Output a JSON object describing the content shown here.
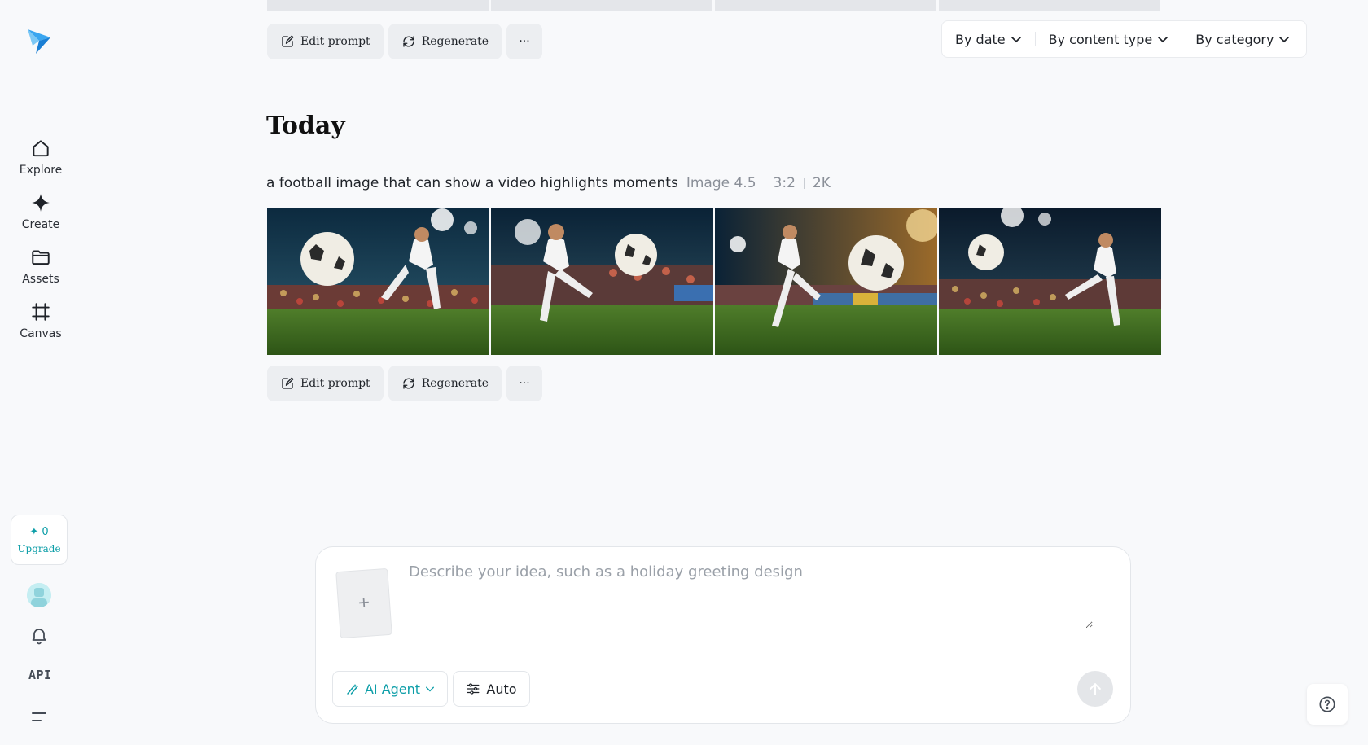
{
  "sidebar": {
    "nav": [
      {
        "label": "Explore",
        "icon": "home-icon"
      },
      {
        "label": "Create",
        "icon": "sparkle-icon"
      },
      {
        "label": "Assets",
        "icon": "folder-icon"
      },
      {
        "label": "Canvas",
        "icon": "canvas-icon"
      }
    ],
    "credits": "0",
    "upgrade_label": "Upgrade",
    "api_label": "API"
  },
  "actions": {
    "edit_prompt": "Edit prompt",
    "regenerate": "Regenerate",
    "more": "···"
  },
  "filters": {
    "by_date": "By date",
    "by_content_type": "By content type",
    "by_category": "By category"
  },
  "section_title": "Today",
  "generation": {
    "prompt": "a football image that can show a video highlights moments",
    "model": "Image 4.5",
    "ratio": "3:2",
    "resolution": "2K"
  },
  "composer": {
    "placeholder": "Describe your idea, such as a holiday greeting design",
    "upload_symbol": "+",
    "agent_label": "AI Agent",
    "auto_label": "Auto"
  },
  "colors": {
    "accent": "#0d9ea8",
    "background": "#f8f9fb"
  }
}
